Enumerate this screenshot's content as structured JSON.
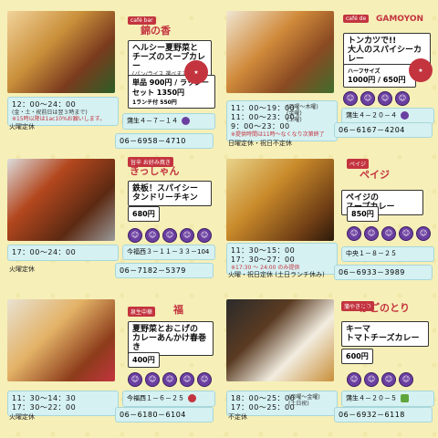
{
  "cards": [
    {
      "kicker": "café bar",
      "name": "錦の香",
      "menu": [
        "ヘルシー夏野菜と",
        "チーズのスープカレー"
      ],
      "menu_note": "(パン/ライス 選べます)",
      "price1": "単品 900円 / ラッシー",
      "price2": "セット 1350円",
      "extra": "1ランチ付 550円",
      "hours": [
        "12：00～24：00"
      ],
      "notes": [
        "(金・土・祝前日は翌３時まで)",
        "※15時以降は1ac10%お願いします。"
      ],
      "closed": "火曜定休",
      "addr": "蒲生４－７－１４",
      "phone": "06－6958－4710",
      "photo_colors": [
        "#c98f3a",
        "#7a3b1e",
        "#2c5e26"
      ]
    },
    {
      "kicker": "café de",
      "name": "GAMOYON",
      "menu": [
        "トンカツで!!",
        "大人のスパイシーカレー"
      ],
      "menu_note": "",
      "price1": "1000円 / 650円",
      "price2": "",
      "extra": "ハーフサイズ",
      "hours": [
        "11：00～19：00",
        "11：00～23：00",
        "9：00～23：00"
      ],
      "hours_side": [
        "(月曜～木曜)",
        "(金曜)",
        "(土曜)"
      ],
      "notes": [
        "※提供時間は11時～なくなり次第終了"
      ],
      "closed": "日曜定休・祝日不定休",
      "addr": "蒲生４－２０－４",
      "phone": "06－6167－4204",
      "photo_colors": [
        "#8a4a22",
        "#d08a3b",
        "#3f6d2d"
      ]
    },
    {
      "kicker": "旨辛 お好み焼き",
      "name": "きっしゃん",
      "menu": [
        "鉄板！スパイシー",
        "タンドリーチキン"
      ],
      "menu_note": "",
      "price1": "680円",
      "price2": "",
      "extra": "",
      "hours": [
        "17：00～24：00"
      ],
      "notes": [],
      "closed": "火曜定休",
      "addr": "今福西３－１１－３３－104",
      "phone": "06－7182－5379",
      "photo_colors": [
        "#b3471e",
        "#5c2a12",
        "#999999"
      ]
    },
    {
      "kicker": "ペイジ",
      "name": "ペイジ",
      "menu": [
        "ペイジの",
        "スープカレー"
      ],
      "menu_note": "",
      "price1": "850円",
      "price2": "",
      "extra": "",
      "hours": [
        "11：30～15：00",
        "17：30～27：00"
      ],
      "notes": [
        "※17:30 ～ 24:00 のみ提供"
      ],
      "closed": "火曜・祝日定休 (土日ランチ休み)",
      "addr": "中央１－８－２５",
      "phone": "06－6933－3989",
      "photo_colors": [
        "#6b3b14",
        "#c98a2b",
        "#e8d38a"
      ]
    },
    {
      "kicker": "泉生中華",
      "name": "福",
      "menu": [
        "夏野菜とおこげの",
        "カレーあんかけ春巻き"
      ],
      "menu_note": "",
      "price1": "400円",
      "price2": "",
      "extra": "",
      "hours": [
        "11：30～14：30",
        "17：30～22：00"
      ],
      "notes": [],
      "closed": "火曜定休",
      "addr": "今福西１－６－２５",
      "phone": "06－6180－6104",
      "photo_colors": [
        "#e3b267",
        "#8d3c1a",
        "#e8e2d2"
      ]
    },
    {
      "kicker": "蒲やきとり",
      "name": "かごのとり",
      "menu": [
        "キーマ",
        "トマトチーズカレー"
      ],
      "menu_note": "",
      "price1": "600円",
      "price2": "",
      "extra": "",
      "hours": [
        "18：00～25：00",
        "17：00～25：00"
      ],
      "hours_side": [
        "(月曜～金曜)",
        "(土日祝)"
      ],
      "notes": [],
      "closed": "不定休",
      "addr": "蒲生４－２０－５",
      "phone": "06－6932－6118",
      "photo_colors": [
        "#f2ede0",
        "#5a3b22",
        "#2b2b2b"
      ]
    }
  ],
  "colors": {
    "accent": "#c3343f",
    "bubble": "#d6f1f2",
    "icon": "#6b3fa0",
    "bg": "#f6efb8"
  },
  "icon_glyph": "☺"
}
